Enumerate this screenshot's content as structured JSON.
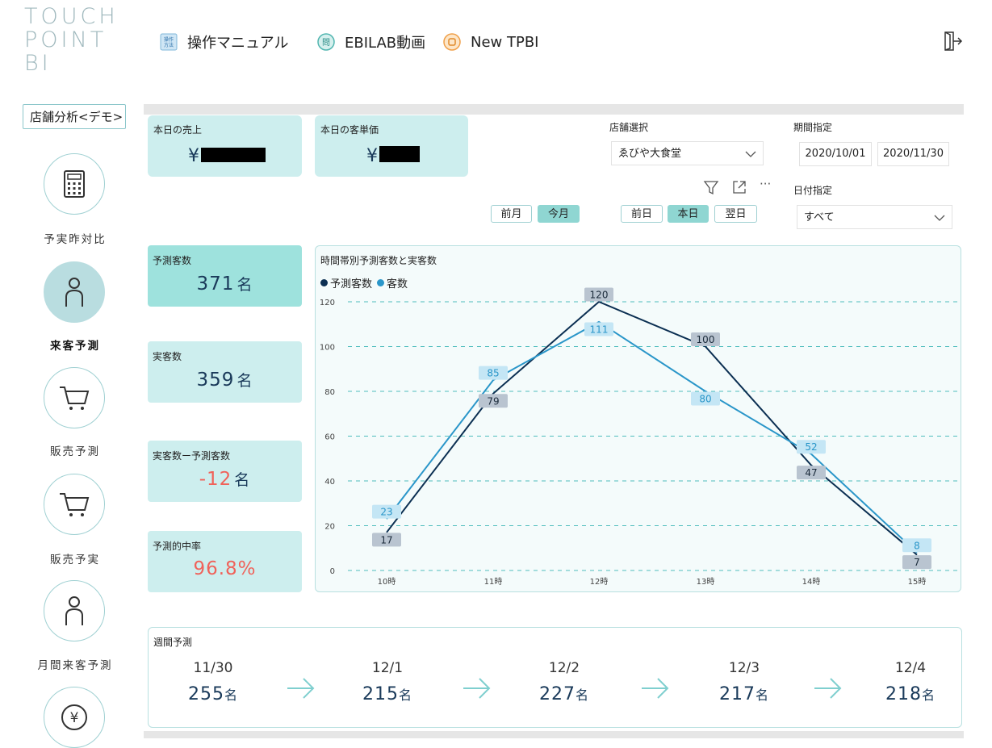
{
  "logo": {
    "line1": "TOUCH",
    "line2": "POINT",
    "line3": "BI"
  },
  "toplinks": {
    "manual": "操作マニュアル",
    "video": "EBILAB動画",
    "tpbi": "New TPBI",
    "manual_icon_text": "操作\n方法",
    "video_icon_text": "問"
  },
  "sidebar": {
    "store_select": "店舗分析<デモ>",
    "items": [
      {
        "label": "予実昨対比",
        "icon": "calculator-icon"
      },
      {
        "label": "来客予測",
        "icon": "person-icon",
        "active": true
      },
      {
        "label": "販売予測",
        "icon": "cart-icon"
      },
      {
        "label": "販売予実",
        "icon": "cart-icon"
      },
      {
        "label": "月間来客予測",
        "icon": "person-icon"
      },
      {
        "label": "",
        "icon": "yen-icon"
      }
    ],
    "yen_symbol": "¥"
  },
  "summary": {
    "sales_title": "本日の売上",
    "unit_price_title": "本日の客単価",
    "yen": "¥"
  },
  "filters": {
    "store_label": "店舗選択",
    "store_value": "ゑびや大食堂",
    "period_label": "期間指定",
    "period_start": "2020/10/01",
    "period_end": "2020/11/30",
    "date_label": "日付指定",
    "date_value": "すべて",
    "more": "···"
  },
  "buttons": {
    "prev_month": "前月",
    "this_month": "今月",
    "prev_day": "前日",
    "today": "本日",
    "next_day": "翌日"
  },
  "kpis": {
    "predicted": {
      "title": "予測客数",
      "value": "371",
      "unit": "名"
    },
    "actual": {
      "title": "実客数",
      "value": "359",
      "unit": "名"
    },
    "diff": {
      "title": "実客数ー予測客数",
      "value": "-12",
      "unit": "名"
    },
    "accuracy": {
      "title": "予測的中率",
      "value": "96.8%"
    }
  },
  "chart_data": {
    "type": "line",
    "title": "時間帯別予測客数と実客数",
    "categories": [
      "10時",
      "11時",
      "12時",
      "13時",
      "14時",
      "15時"
    ],
    "series": [
      {
        "name": "予測客数",
        "color": "#0b2f52",
        "values": [
          17,
          79,
          120,
          100,
          47,
          7
        ]
      },
      {
        "name": "客数",
        "color": "#2a96c9",
        "values": [
          23,
          85,
          111,
          80,
          52,
          8
        ]
      }
    ],
    "ylim": [
      0,
      120
    ],
    "yticks": [
      0,
      20,
      40,
      60,
      80,
      100,
      120
    ],
    "grid": true,
    "legend": "top-left"
  },
  "weekly": {
    "title": "週間予測",
    "days": [
      {
        "date": "11/30",
        "value": "255",
        "unit": "名"
      },
      {
        "date": "12/1",
        "value": "215",
        "unit": "名"
      },
      {
        "date": "12/2",
        "value": "227",
        "unit": "名"
      },
      {
        "date": "12/3",
        "value": "217",
        "unit": "名"
      },
      {
        "date": "12/4",
        "value": "218",
        "unit": "名"
      }
    ]
  }
}
